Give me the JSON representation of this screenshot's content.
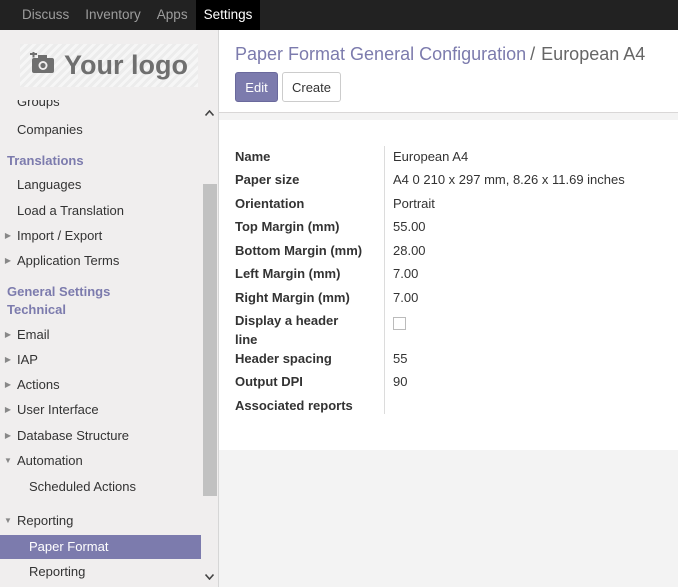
{
  "topbar": {
    "items": [
      {
        "label": "Discuss",
        "active": false
      },
      {
        "label": "Inventory",
        "active": false
      },
      {
        "label": "Apps",
        "active": false
      },
      {
        "label": "Settings",
        "active": true
      }
    ]
  },
  "logo": {
    "text": "Your logo",
    "icon": "camera-plus-icon"
  },
  "sidebar": {
    "groups_partial": "Groups",
    "companies": "Companies",
    "translations_header": "Translations",
    "languages": "Languages",
    "load_translation": "Load a Translation",
    "import_export": "Import / Export",
    "application_terms": "Application Terms",
    "general_settings_header": "General Settings",
    "technical_header": "Technical",
    "email": "Email",
    "iap": "IAP",
    "actions": "Actions",
    "user_interface": "User Interface",
    "database_structure": "Database Structure",
    "automation": "Automation",
    "scheduled_actions": "Scheduled Actions",
    "reporting": "Reporting",
    "paper_format": "Paper Format",
    "reporting_sub": "Reporting"
  },
  "breadcrumb": {
    "parent": "Paper Format General Configuration",
    "separator": "/",
    "current": "European A4"
  },
  "buttons": {
    "edit": "Edit",
    "create": "Create"
  },
  "form": {
    "name_label": "Name",
    "name_value": "European A4",
    "paper_size_label": "Paper size",
    "paper_size_value": "A4 0 210 x 297 mm, 8.26 x 11.69 inches",
    "orientation_label": "Orientation",
    "orientation_value": "Portrait",
    "top_margin_label": "Top Margin (mm)",
    "top_margin_value": "55.00",
    "bottom_margin_label": "Bottom Margin (mm)",
    "bottom_margin_value": "28.00",
    "left_margin_label": "Left Margin (mm)",
    "left_margin_value": "7.00",
    "right_margin_label": "Right Margin (mm)",
    "right_margin_value": "7.00",
    "display_header_label_1": "Display a header",
    "display_header_label_2": "line",
    "display_header_checked": false,
    "header_spacing_label": "Header spacing",
    "header_spacing_value": "55",
    "output_dpi_label": "Output DPI",
    "output_dpi_value": "90",
    "associated_reports_label": "Associated reports"
  },
  "colors": {
    "accent": "#7c7bad",
    "topbar": "#222222"
  }
}
